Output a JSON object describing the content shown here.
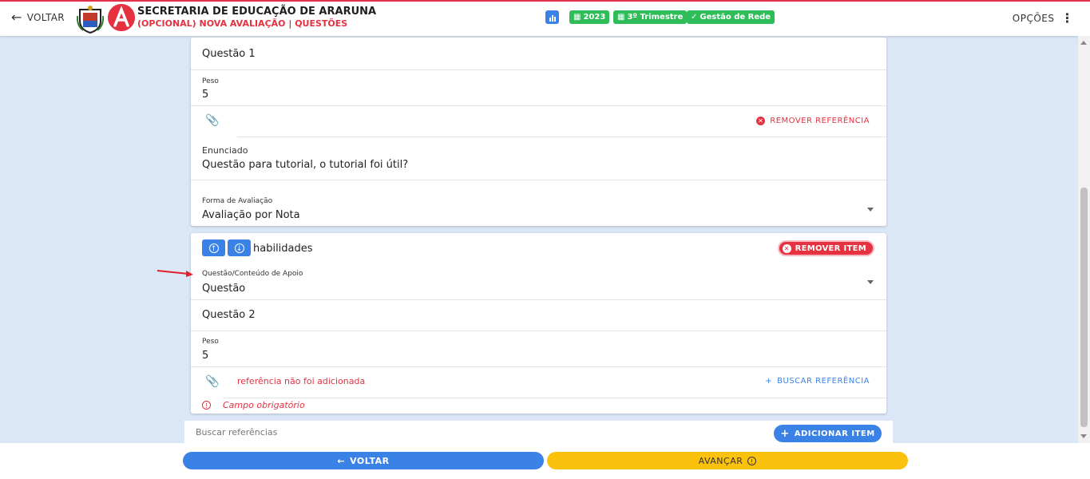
{
  "header": {
    "back_label": "VOLTAR",
    "org_title": "SECRETARIA DE EDUCAÇÃO DE ARARUNA",
    "page_subtitle": "(OPCIONAL) NOVA AVALIAÇÃO | QUESTÕES",
    "badges": [
      "2023",
      "3º Trimestre",
      "Gestão de Rede"
    ],
    "options_label": "OPÇÕES"
  },
  "card1": {
    "question_title": "Questão 1",
    "peso_label": "Peso",
    "peso_value": "5",
    "remove_ref_label": "REMOVER REFERÊNCIA",
    "enunciado_label": "Enunciado",
    "enunciado_value": "Questão para tutorial, o tutorial foi útil?",
    "forma_label": "Forma de Avaliação",
    "forma_value": "Avaliação por Nota"
  },
  "card2": {
    "item_title": "habilidades",
    "remove_item_label": "REMOVER ITEM",
    "tipo_label": "Questão/Conteúdo de Apoio",
    "tipo_value": "Questão",
    "question_title": "Questão 2",
    "peso_label": "Peso",
    "peso_value": "5",
    "ref_error": "referência não foi adicionada",
    "search_ref_label": "BUSCAR REFERÊNCIA",
    "required_msg": "Campo obrigatório"
  },
  "bottom": {
    "search_placeholder": "Buscar referências",
    "add_item_label": "ADICIONAR ITEM"
  },
  "footer": {
    "back_label": "VOLTAR",
    "next_label": "AVANÇAR"
  },
  "colors": {
    "accent_red": "#e53140",
    "primary_blue": "#3b82e6",
    "success_green": "#2ebd59",
    "warning_yellow": "#fbc20d"
  }
}
